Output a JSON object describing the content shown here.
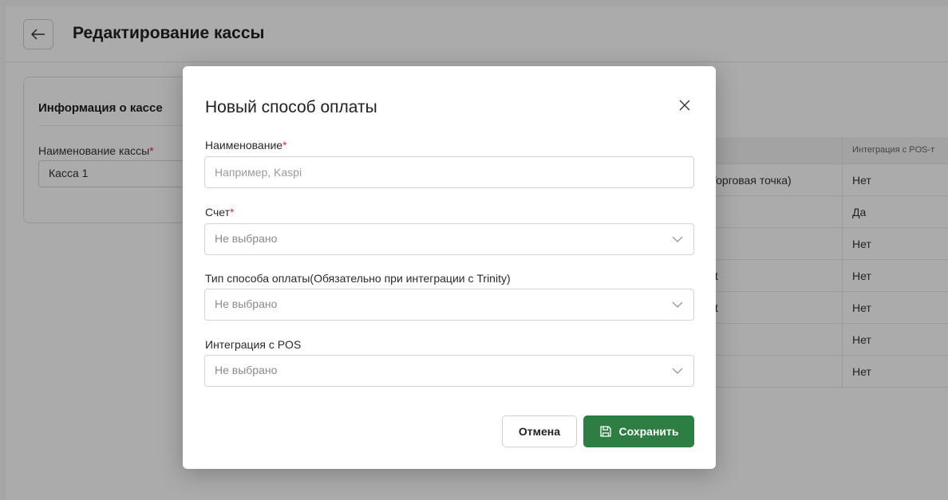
{
  "page": {
    "title": "Редактирование кассы",
    "info_card": {
      "title": "Информация о кассе",
      "name_label": "Наименование кассы",
      "required_mark": "*",
      "name_value": "Касса 1"
    },
    "table": {
      "header": [
        "",
        "Интеграция с POS-т"
      ],
      "rows": [
        [
          "(Торговая точка)",
          "Нет"
        ],
        [
          "",
          "Да"
        ],
        [
          "",
          "Нет"
        ],
        [
          "dit",
          "Нет"
        ],
        [
          "dit",
          "Нет"
        ],
        [
          "",
          "Нет"
        ],
        [
          "",
          "Нет"
        ]
      ]
    }
  },
  "modal": {
    "title": "Новый способ оплаты",
    "fields": {
      "name": {
        "label": "Наименование",
        "required_mark": "*",
        "placeholder": "Например, Kaspi"
      },
      "account": {
        "label": "Счет",
        "required_mark": "*",
        "value": "Не выбрано"
      },
      "payment_type": {
        "label": "Тип способа оплаты(Обязательно при интеграции с Trinity)",
        "value": "Не выбрано"
      },
      "pos": {
        "label": "Интеграция с POS",
        "value": "Не выбрано"
      }
    },
    "cancel_label": "Отмена",
    "save_label": "Сохранить"
  },
  "colors": {
    "accent": "#2e7d43",
    "required": "#d0302f",
    "overlay": "rgba(0,0,0,0.33)"
  },
  "icons": {
    "back": "arrow-left-icon",
    "close": "close-icon",
    "dropdown": "chevron-down-icon",
    "save": "floppy-disk-icon"
  }
}
